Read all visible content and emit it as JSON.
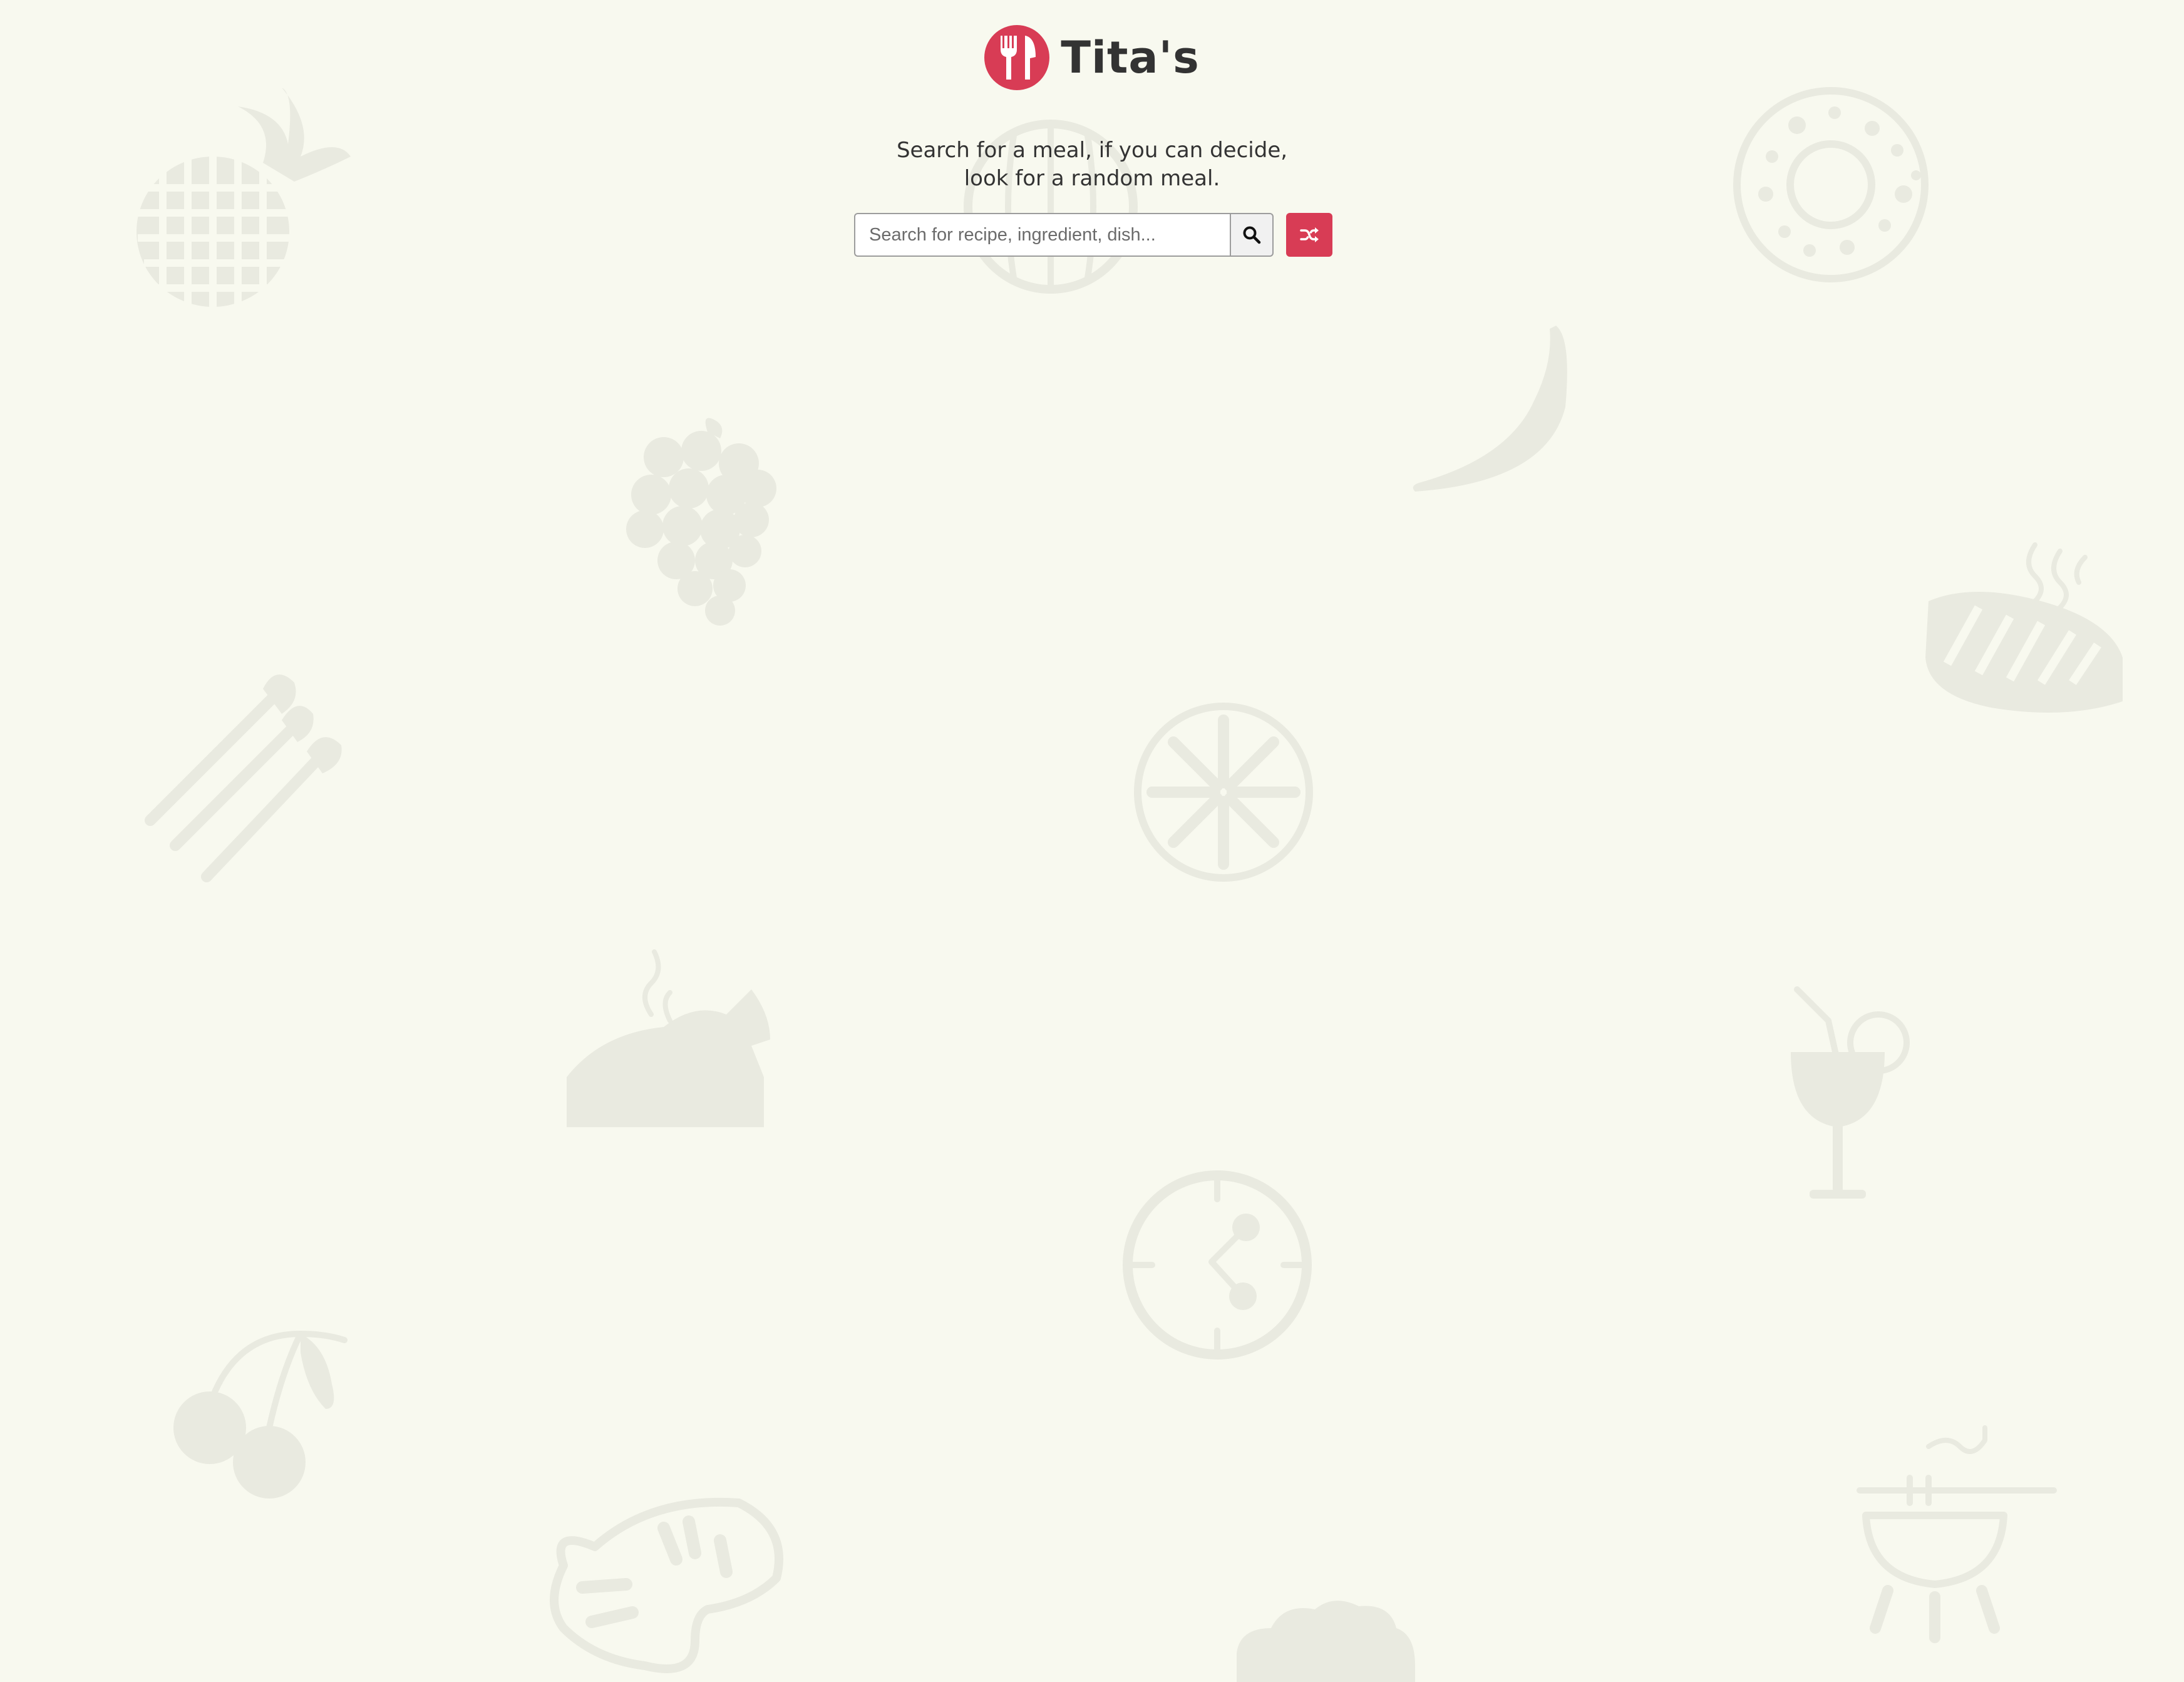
{
  "brand": {
    "name": "Tita's",
    "icon": "utensils-icon"
  },
  "tagline": {
    "line1": "Search for a meal, if you can decide,",
    "line2": "look for a random meal."
  },
  "search": {
    "placeholder": "Search for recipe, ingredient, dish...",
    "value": "",
    "submit_icon": "search-icon",
    "random_icon": "shuffle-icon"
  },
  "colors": {
    "accent": "#d83c55",
    "background": "#f8f9ef",
    "doodle": "#e9eae0",
    "text": "#333333"
  },
  "background_doodles": [
    "pineapple-icon",
    "watermelon-icon",
    "donut-icon",
    "banana-icon",
    "grapes-icon",
    "steak-icon",
    "asparagus-icon",
    "citrus-slice-icon",
    "roast-chicken-icon",
    "cocktail-icon",
    "clock-icon",
    "cherries-icon",
    "bbq-grill-icon",
    "ham-icon",
    "cloud-icon"
  ]
}
